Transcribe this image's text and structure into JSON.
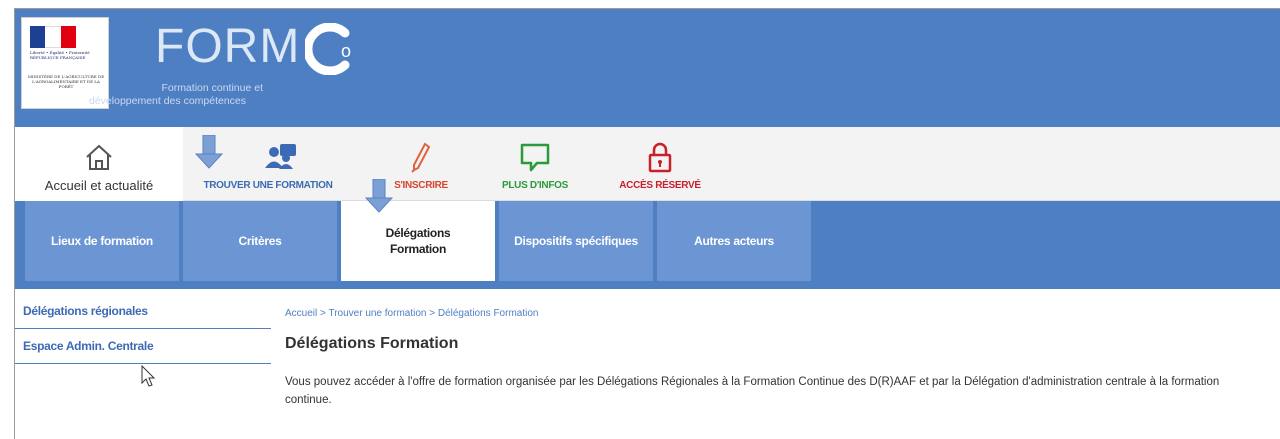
{
  "header": {
    "gov_logo": {
      "republic_text": "Liberté • Égalité • Fraternité RÉPUBLIQUE FRANÇAISE",
      "ministry_text": "MINISTÈRE DE L'AGRICULTURE DE L'AGROALIMENTAIRE ET DE LA FORÊT",
      "colors": [
        "#1d3f94",
        "#ffffff",
        "#e1000f"
      ]
    },
    "brand": "FORM",
    "brand_suffix": "o",
    "tagline_line1": "Formation continue et",
    "tagline_line2": "développement des compétences"
  },
  "topnav": {
    "home_label": "Accueil et actualité",
    "find_label": "TROUVER UNE FORMATION",
    "subscribe_label": "S'INSCRIRE",
    "info_label": "PLUS D'INFOS",
    "private_label": "ACCÈS RÉSERVÉ",
    "colors": {
      "find": "#3d6ab4",
      "subscribe": "#d9442c",
      "info": "#2a9a3a",
      "private": "#c8202a"
    }
  },
  "tabs": [
    {
      "label": "Lieux de formation"
    },
    {
      "label": "Critères"
    },
    {
      "label": "Délégations Formation",
      "active": true
    },
    {
      "label": "Dispositifs spécifiques"
    },
    {
      "label": "Autres acteurs"
    }
  ],
  "sidebar": {
    "items": [
      {
        "label": "Délégations régionales"
      },
      {
        "label": "Espace Admin. Centrale"
      }
    ]
  },
  "content": {
    "breadcrumb": "Accueil > Trouver une formation > Délégations Formation",
    "title": "Délégations Formation",
    "intro": "Vous pouvez accéder à l'offre de formation organisée par les Délégations Régionales à la Formation Continue des D(R)AAF et par la Délégation d'administration centrale à la formation continue."
  },
  "colors": {
    "brand_blue": "#4f7fc3",
    "tab_blue": "#6b95d3",
    "arrow_blue": "#7ca0d6"
  }
}
